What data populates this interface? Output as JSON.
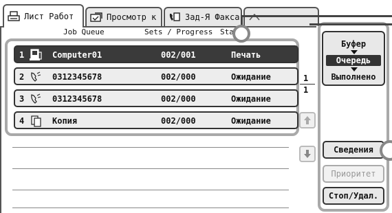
{
  "tabs": [
    {
      "label": "Лист Работ",
      "icon": "print-icon",
      "active": true
    },
    {
      "label": "Просмотр к",
      "icon": "scan-icon",
      "active": false
    },
    {
      "label": "Зад-Я Факса",
      "icon": "fax-icon",
      "active": false
    },
    {
      "label": "",
      "icon": "tab-icon",
      "active": false
    }
  ],
  "columns": {
    "job_queue": "Job Queue",
    "sets_progress": "Sets / Progress",
    "status": "Status"
  },
  "jobs": [
    {
      "num": "1",
      "icon": "computer-icon",
      "name": "Computer01",
      "sets": "002/001",
      "status": "Печать",
      "selected": true
    },
    {
      "num": "2",
      "icon": "fax-phone-icon",
      "name": "0312345678",
      "sets": "002/000",
      "status": "Ожидание",
      "selected": false
    },
    {
      "num": "3",
      "icon": "fax-phone-icon",
      "name": "0312345678",
      "sets": "002/000",
      "status": "Ожидание",
      "selected": false
    },
    {
      "num": "4",
      "icon": "copy-icon",
      "name": "Копия",
      "sets": "002/000",
      "status": "Ожидание",
      "selected": false
    }
  ],
  "pager": {
    "current": "1",
    "total": "1"
  },
  "modes": {
    "spool": "Буфер",
    "queue": "Очередь",
    "complete": "Выполнено",
    "selected": "queue"
  },
  "buttons": {
    "details": "Сведения",
    "priority": "Приоритет",
    "stop_delete": "Стоп/Удал."
  },
  "colors": {
    "selected_row": "#3a3a3a",
    "frame": "#a9a9a9"
  }
}
